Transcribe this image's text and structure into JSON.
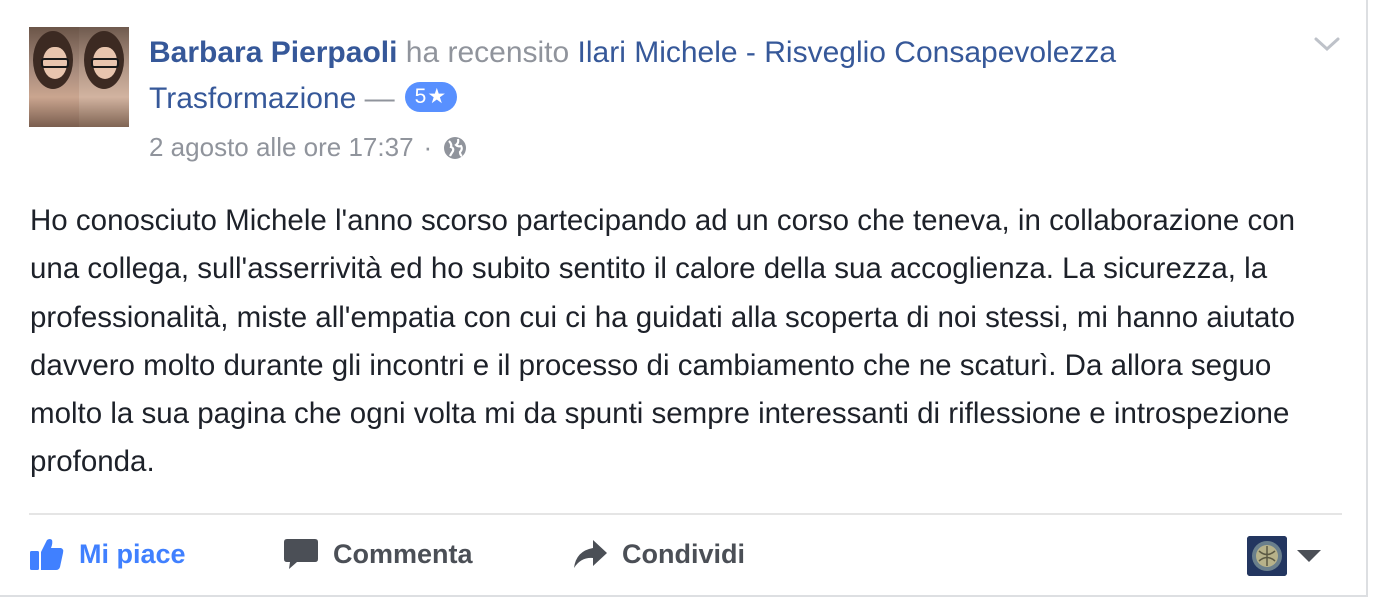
{
  "post": {
    "author_name": "Barbara Pierpaoli",
    "action_text": " ha recensito ",
    "page_name": "Ilari Michele - Risveglio Consapevolezza Trasformazione",
    "dash": " —",
    "rating": "5★",
    "timestamp": "2 agosto alle ore 17:37",
    "separator": "·",
    "privacy_icon": "globe-icon",
    "body": "Ho conosciuto Michele l'anno scorso partecipando ad un corso che teneva, in collaborazione con una collega, sull'asserrività ed ho subito sentito il calore della sua accoglienza. La sicurezza, la professionalità, miste all'empatia con cui ci ha guidati alla scoperta di noi stessi, mi hanno aiutato davvero molto durante gli incontri e il processo di cambiamento che ne scaturì. Da allora seguo molto la sua pagina che ogni volta mi da spunti sempre interessanti di riflessione e introspezione profonda."
  },
  "actions": {
    "like_label": "Mi piace",
    "comment_label": "Commenta",
    "share_label": "Condividi"
  },
  "colors": {
    "link": "#365899",
    "muted": "#90949c",
    "like_blue": "#4080ff",
    "badge": "#5890ff",
    "text": "#1d2129"
  }
}
